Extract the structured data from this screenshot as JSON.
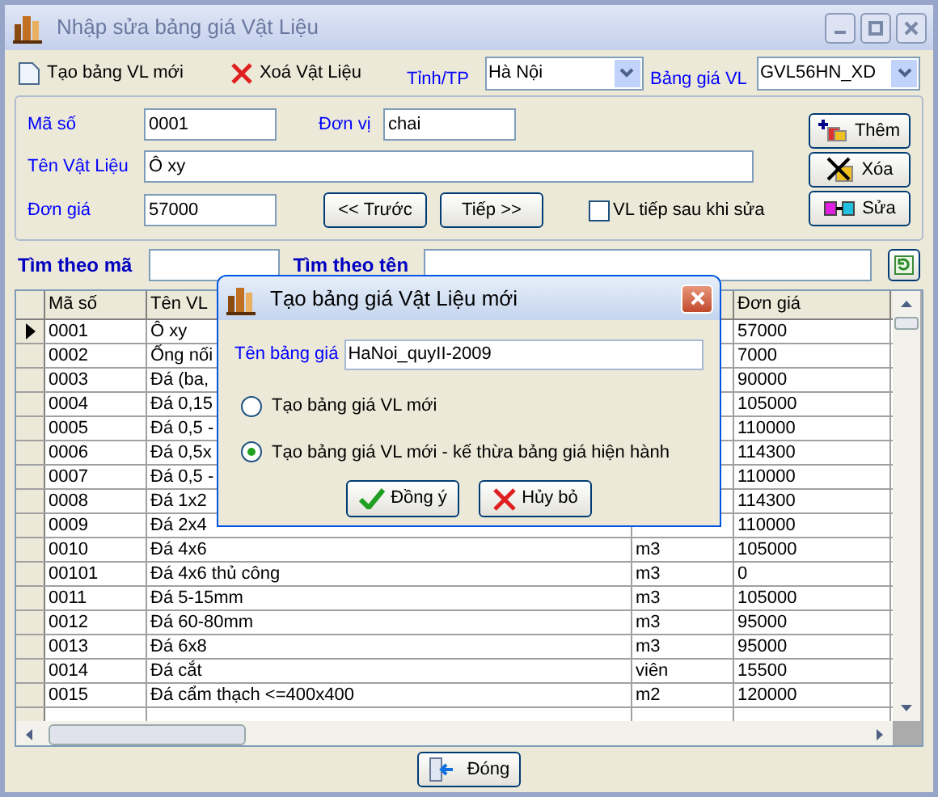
{
  "window": {
    "title": "Nhập sửa bảng giá Vật Liệu"
  },
  "toolbar": {
    "new_table": "Tạo bảng VL mới",
    "delete": "Xoá Vật Liệu",
    "province_label": "Tỉnh/TP",
    "province_value": "Hà Nội",
    "price_table_label": "Bảng giá VL",
    "price_table_value": "GVL56HN_XD"
  },
  "form": {
    "code_label": "Mã số",
    "code_value": "0001",
    "unit_label": "Đơn vị",
    "unit_value": "chai",
    "name_label": "Tên Vật Liệu",
    "name_value": "Ô xy",
    "price_label": "Đơn giá",
    "price_value": "57000",
    "prev": "<< Trước",
    "next": "Tiếp >>",
    "next_after_edit": {
      "label": "VL tiếp sau khi sửa",
      "checked": false
    },
    "side_buttons": [
      {
        "kind": "add",
        "label": "Thêm"
      },
      {
        "kind": "delete",
        "label": "Xóa"
      },
      {
        "kind": "edit",
        "label": "Sửa"
      }
    ]
  },
  "search": {
    "by_code_label": "Tìm theo mã",
    "by_name_label": "Tìm theo tên"
  },
  "table": {
    "columns": [
      "Mã số",
      "Tên VL",
      "Đơn giá"
    ],
    "rows": [
      {
        "code": "0001",
        "name": "Ô xy",
        "price": "57000",
        "selected": true
      },
      {
        "code": "0002",
        "name": "Ống nối",
        "price": "7000",
        "selected": false
      },
      {
        "code": "0003",
        "name": "Đá (ba,",
        "price": "90000",
        "selected": false
      },
      {
        "code": "0004",
        "name": "Đá 0,15",
        "price": "105000",
        "selected": false
      },
      {
        "code": "0005",
        "name": "Đá 0,5 -",
        "price": "110000",
        "selected": false
      },
      {
        "code": "0006",
        "name": "Đá 0,5x",
        "price": "114300",
        "selected": false
      },
      {
        "code": "0007",
        "name": "Đá 0,5 -",
        "price": "110000",
        "selected": false
      },
      {
        "code": "0008",
        "name": "Đá 1x2",
        "price": "114300",
        "selected": false
      },
      {
        "code": "0009",
        "name": "Đá 2x4",
        "price": "110000",
        "selected": false
      },
      {
        "code": "0010",
        "name": "Đá 4x6",
        "unit": "m3",
        "price": "105000",
        "selected": false
      },
      {
        "code": "00101",
        "name": "Đá 4x6 thủ công",
        "unit": "m3",
        "price": "0",
        "selected": false
      },
      {
        "code": "0011",
        "name": "Đá 5-15mm",
        "unit": "m3",
        "price": "105000",
        "selected": false
      },
      {
        "code": "0012",
        "name": "Đá 60-80mm",
        "unit": "m3",
        "price": "95000",
        "selected": false
      },
      {
        "code": "0013",
        "name": "Đá 6x8",
        "unit": "m3",
        "price": "95000",
        "selected": false
      },
      {
        "code": "0014",
        "name": "Đá cắt",
        "unit": "viên",
        "price": "15500",
        "selected": false
      },
      {
        "code": "0015",
        "name": "Đá cẩm thạch <=400x400",
        "unit": "m2",
        "price": "120000",
        "selected": false
      }
    ]
  },
  "close_button": "Đóng",
  "dialog": {
    "title": "Tạo bảng giá Vật Liệu mới",
    "name_label": "Tên bảng giá",
    "name_value": "HaNoi_quyII-2009",
    "options": [
      {
        "label": "Tạo bảng giá VL mới",
        "selected": false
      },
      {
        "label": "Tạo bảng giá VL mới - kế thừa bảng giá hiện hành",
        "selected": true
      }
    ],
    "ok": "Đồng ý",
    "cancel": "Hủy bỏ"
  }
}
